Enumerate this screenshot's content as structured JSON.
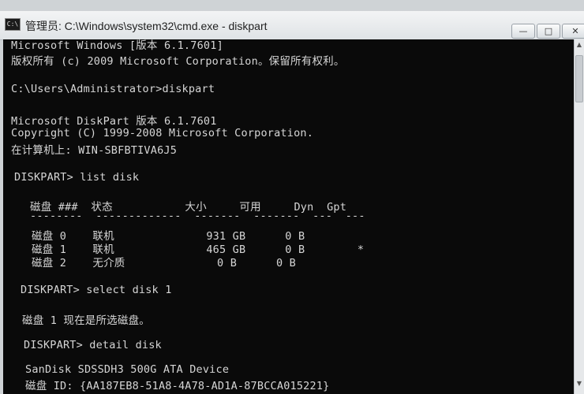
{
  "window": {
    "title": "管理员: C:\\Windows\\system32\\cmd.exe - diskpart",
    "icon_label": "C:\\",
    "controls": {
      "minimize": "—",
      "maximize": "□",
      "close": "✕"
    }
  },
  "console": {
    "lines": {
      "l1": "Microsoft Windows [版本 6.1.7601]",
      "l2": "版权所有 (c) 2009 Microsoft Corporation。保留所有权利。",
      "l3": "C:\\Users\\Administrator>diskpart",
      "l4": "Microsoft DiskPart 版本 6.1.7601",
      "l5": "Copyright (C) 1999-2008 Microsoft Corporation.",
      "l6": "在计算机上: WIN-SBFBTIVA6J5",
      "l7": "DISKPART> list disk",
      "l8": "磁盘 ###  状态           大小     可用     Dyn  Gpt",
      "l9": "--------  -------------  -------  -------  ---  ---",
      "l10": "磁盘 0    联机              931 GB      0 B",
      "l11": "磁盘 1    联机              465 GB      0 B        *",
      "l12": "磁盘 2    无介质              0 B      0 B",
      "l13": "DISKPART> select disk 1",
      "l14": "磁盘 1 现在是所选磁盘。",
      "l15": "DISKPART> detail disk",
      "l16": "SanDisk SDSSDH3 500G ATA Device",
      "l17": "磁盘 ID: {AA187EB8-51A8-4A78-AD1A-87BCCA015221}"
    }
  },
  "colors": {
    "console_bg": "#0a0a0a",
    "console_text": "#d6d6d6"
  }
}
